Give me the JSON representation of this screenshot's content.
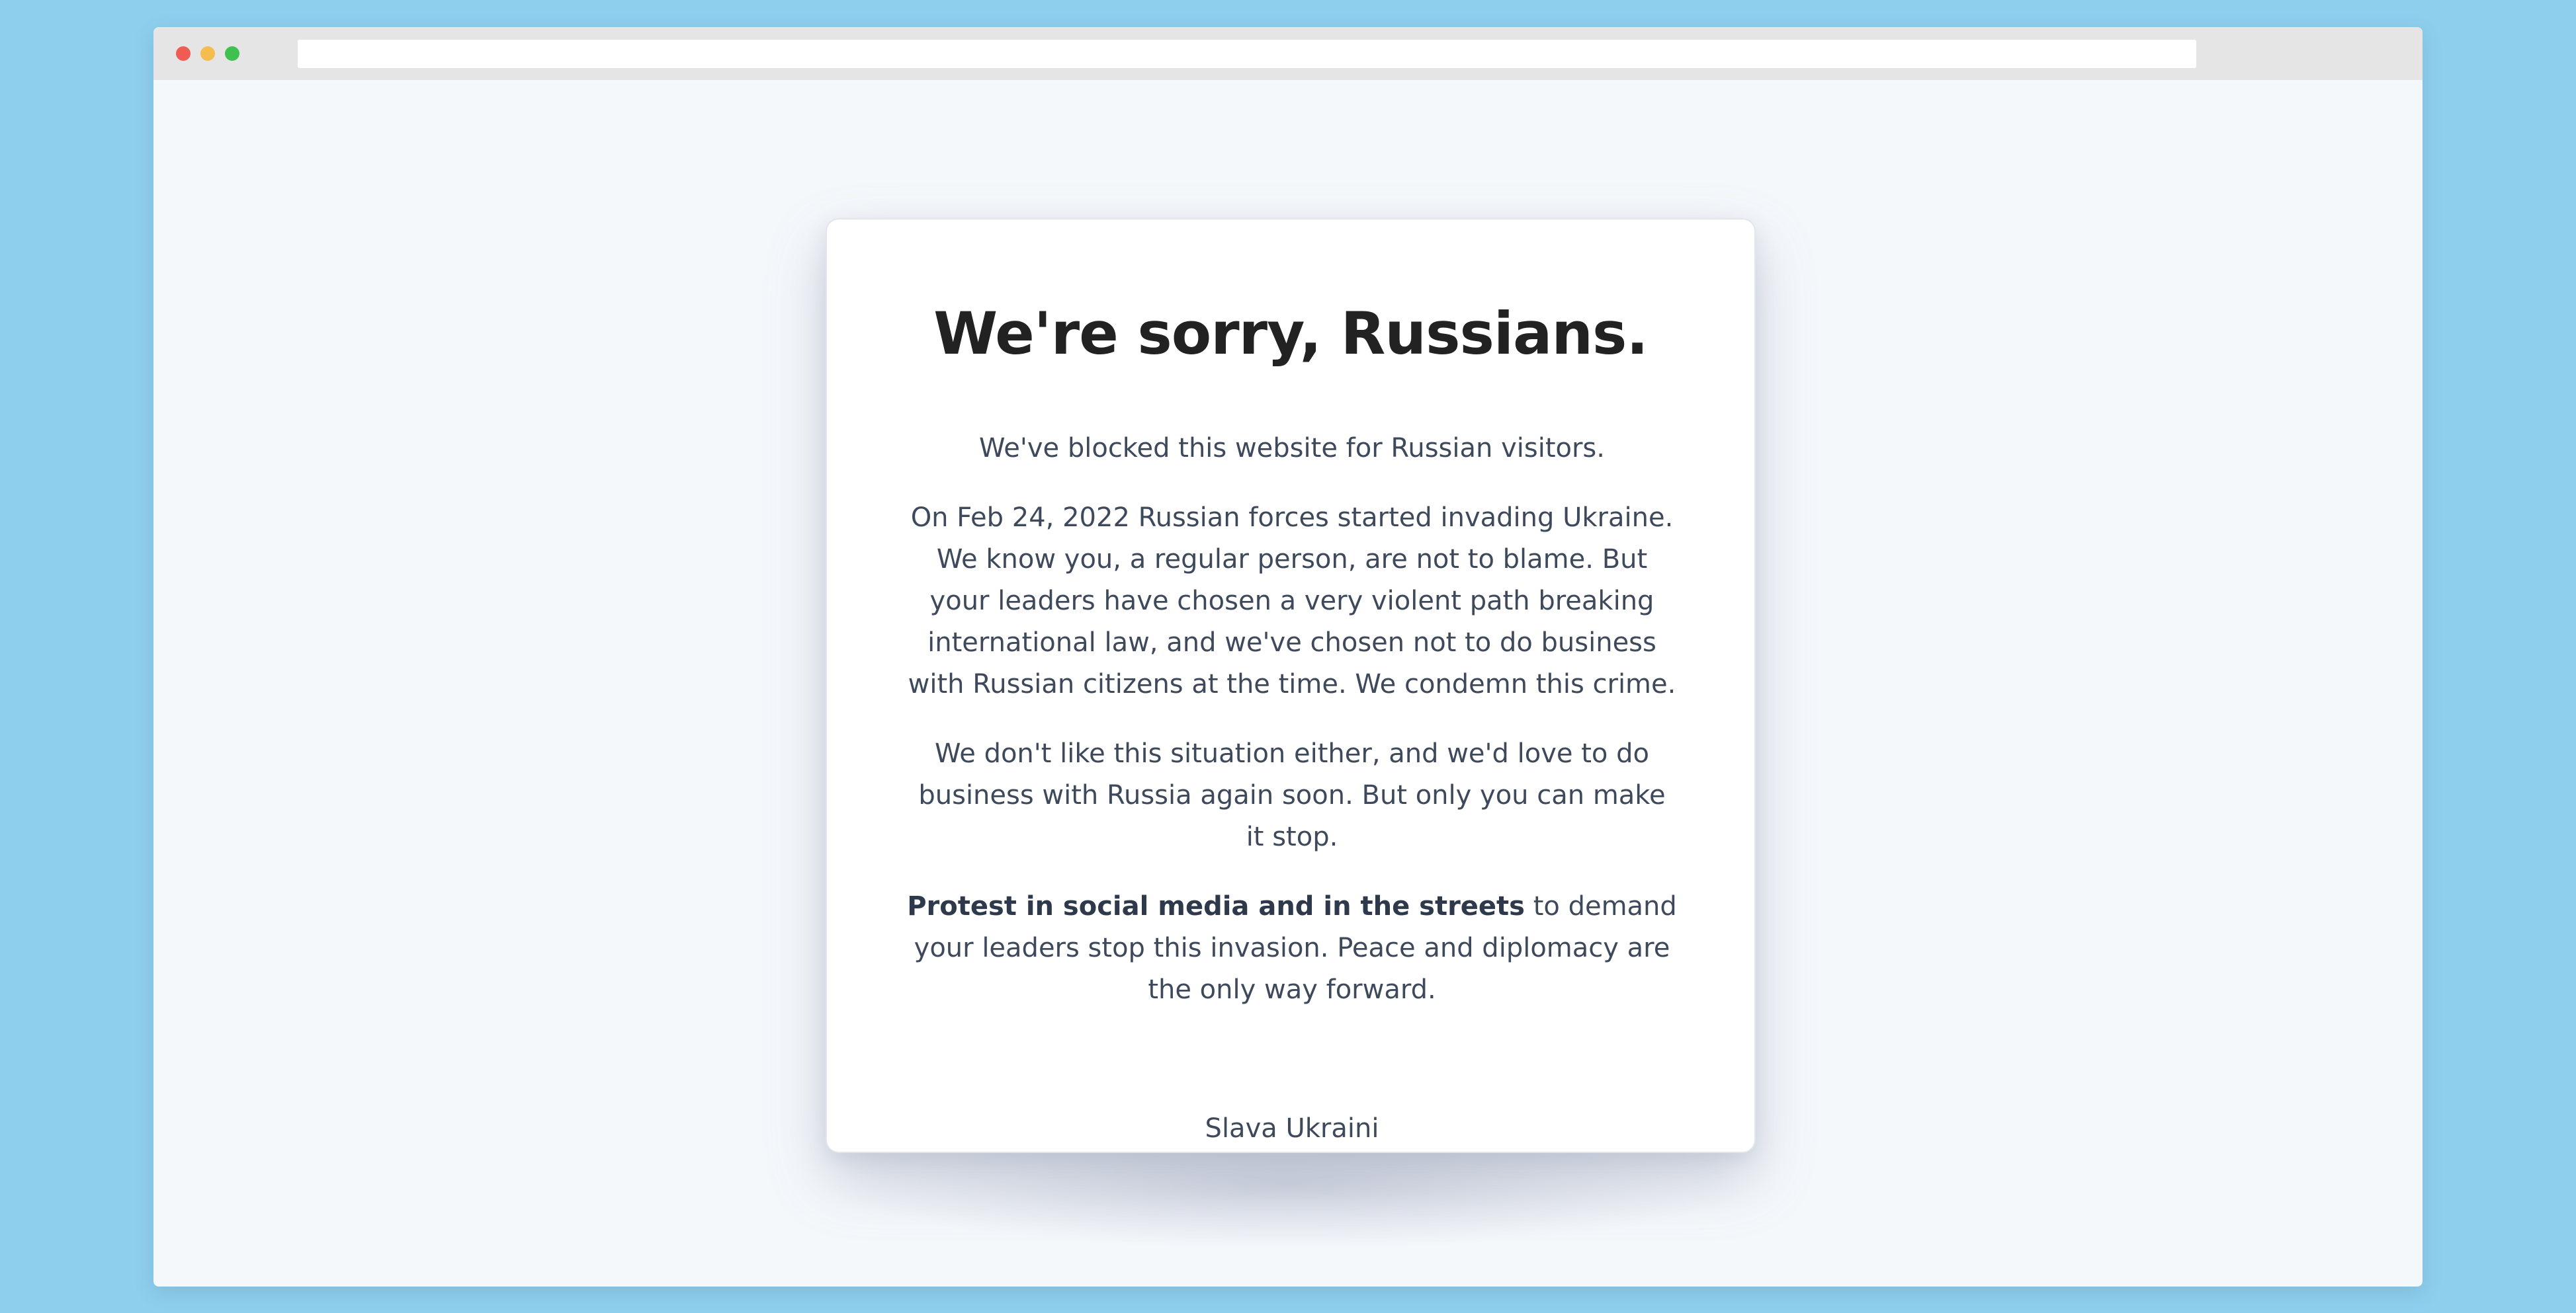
{
  "window": {
    "traffic_lights": {
      "close_color": "#ee5c54",
      "minimize_color": "#f5bd4f",
      "maximize_color": "#3fc04f"
    }
  },
  "notice": {
    "title": "We're sorry, Russians.",
    "paragraph_1": "We've blocked this website for Russian visitors.",
    "paragraph_2": "On Feb 24, 2022 Russian forces started invading Ukraine. We know you, a regular person, are not to blame. But your leaders have chosen a very violent path breaking international law, and we've chosen not to do business with Russian citizens at the time. We condemn this crime.",
    "paragraph_3": "We don't like this situation either, and we'd love to do business with Russia again soon. But only you can make it stop.",
    "paragraph_4_bold": "Protest in social media and in the streets",
    "paragraph_4_rest": " to demand your leaders stop this invasion. Peace and diplomacy are the only way forward.",
    "closing": "Slava Ukraini",
    "flag_icon": "ukraine-flag-icon",
    "flag_colors": [
      "#3b6fd8",
      "#f5d02a"
    ]
  }
}
